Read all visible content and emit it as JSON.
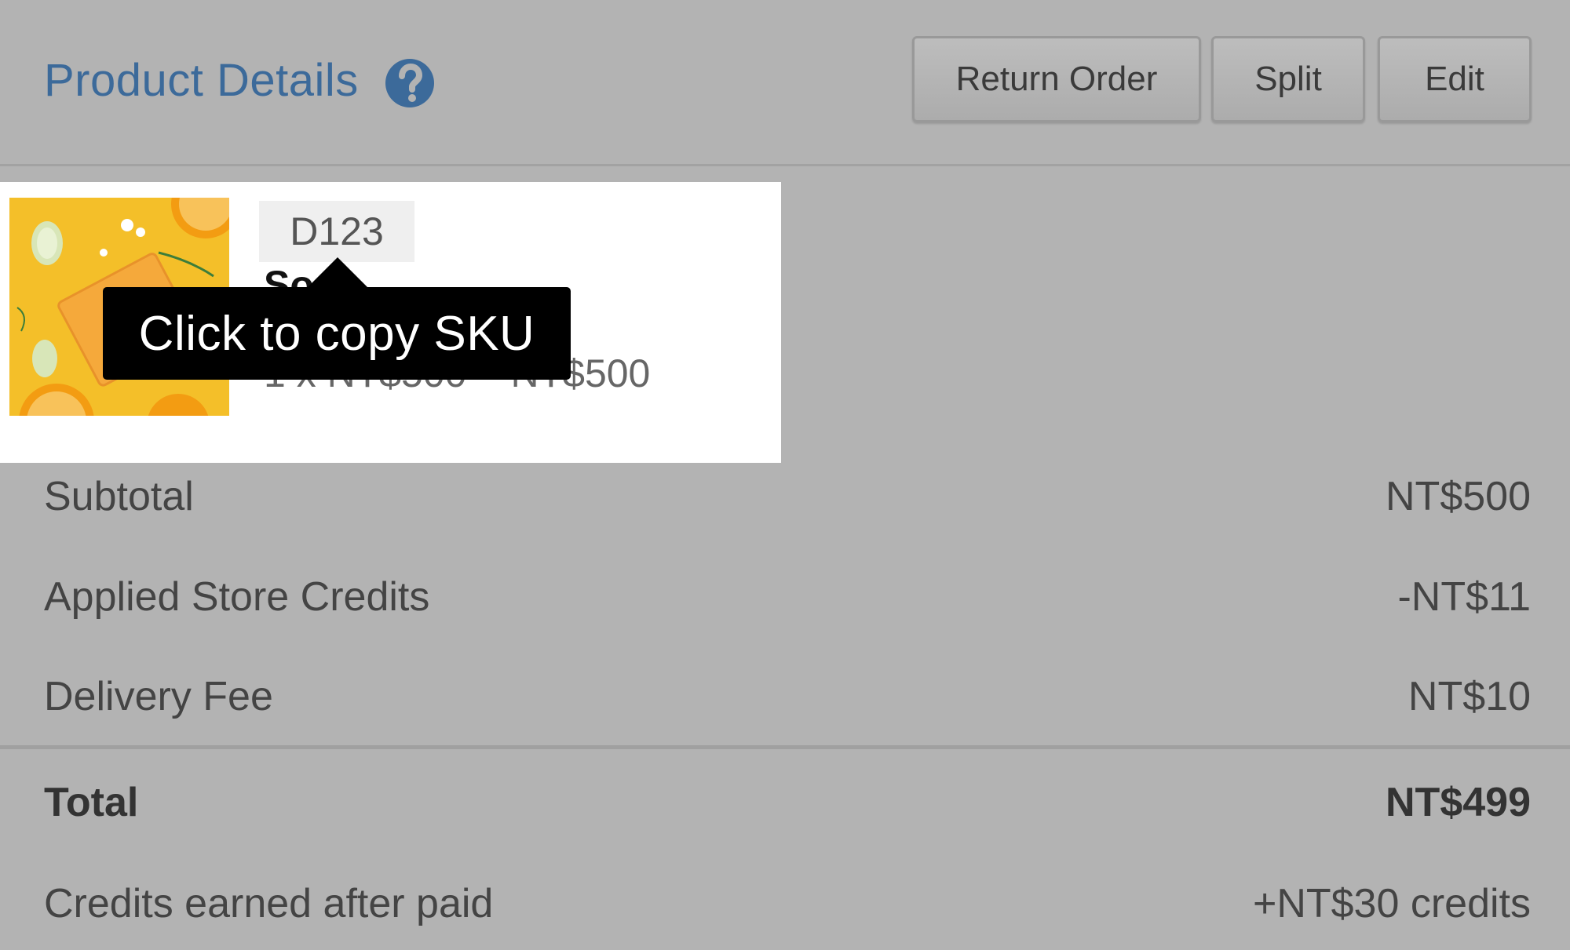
{
  "header": {
    "title": "Product Details",
    "help_icon": "question-circle-icon",
    "buttons": {
      "return_order": "Return Order",
      "split": "Split",
      "edit": "Edit"
    }
  },
  "product": {
    "sku": "D123",
    "name_fragment": "So",
    "unit_price_line": "1 x NT$500",
    "line_total": "NT$500",
    "tooltip": "Click to copy SKU",
    "image_icon": "product-photo-icon"
  },
  "summary": {
    "subtotal_label": "Subtotal",
    "subtotal_value": "NT$500",
    "store_credits_label": "Applied Store Credits",
    "store_credits_value": "-NT$11",
    "delivery_label": "Delivery Fee",
    "delivery_value": "NT$10",
    "total_label": "Total",
    "total_value": "NT$499",
    "earned_label": "Credits earned after paid",
    "earned_value": "+NT$30 credits"
  },
  "colors": {
    "title": "#3c6a9a",
    "overlay": "#b3b3b3",
    "tooltip_bg": "#000000"
  }
}
